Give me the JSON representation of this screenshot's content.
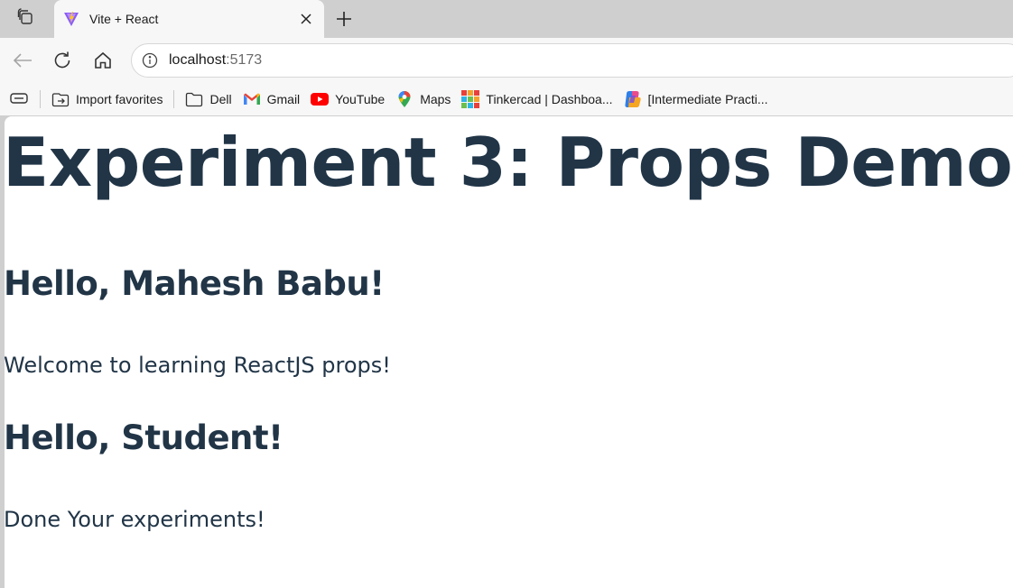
{
  "browser": {
    "tab": {
      "title": "Vite + React"
    },
    "address": {
      "host": "localhost",
      "port": ":5173"
    },
    "favorites": [
      {
        "label": "Import favorites",
        "icon": "import-favorites-icon"
      },
      {
        "label": "Dell",
        "icon": "folder-icon"
      },
      {
        "label": "Gmail",
        "icon": "gmail-icon"
      },
      {
        "label": "YouTube",
        "icon": "youtube-icon"
      },
      {
        "label": "Maps",
        "icon": "maps-icon"
      },
      {
        "label": "Tinkercad | Dashboa...",
        "icon": "tinkercad-icon"
      },
      {
        "label": "[Intermediate Practi...",
        "icon": "copilot-icon"
      }
    ]
  },
  "page": {
    "title": "Experiment 3: Props Demo",
    "cards": [
      {
        "greeting": "Hello, Mahesh Babu!",
        "message": "Welcome to learning ReactJS props!"
      },
      {
        "greeting": "Hello, Student!",
        "message": "Done Your experiments!"
      }
    ]
  },
  "colors": {
    "text": "#213547",
    "chrome": "#f7f7f7",
    "tabstrip": "#cfcfcf",
    "youtube": "#ff0000"
  }
}
